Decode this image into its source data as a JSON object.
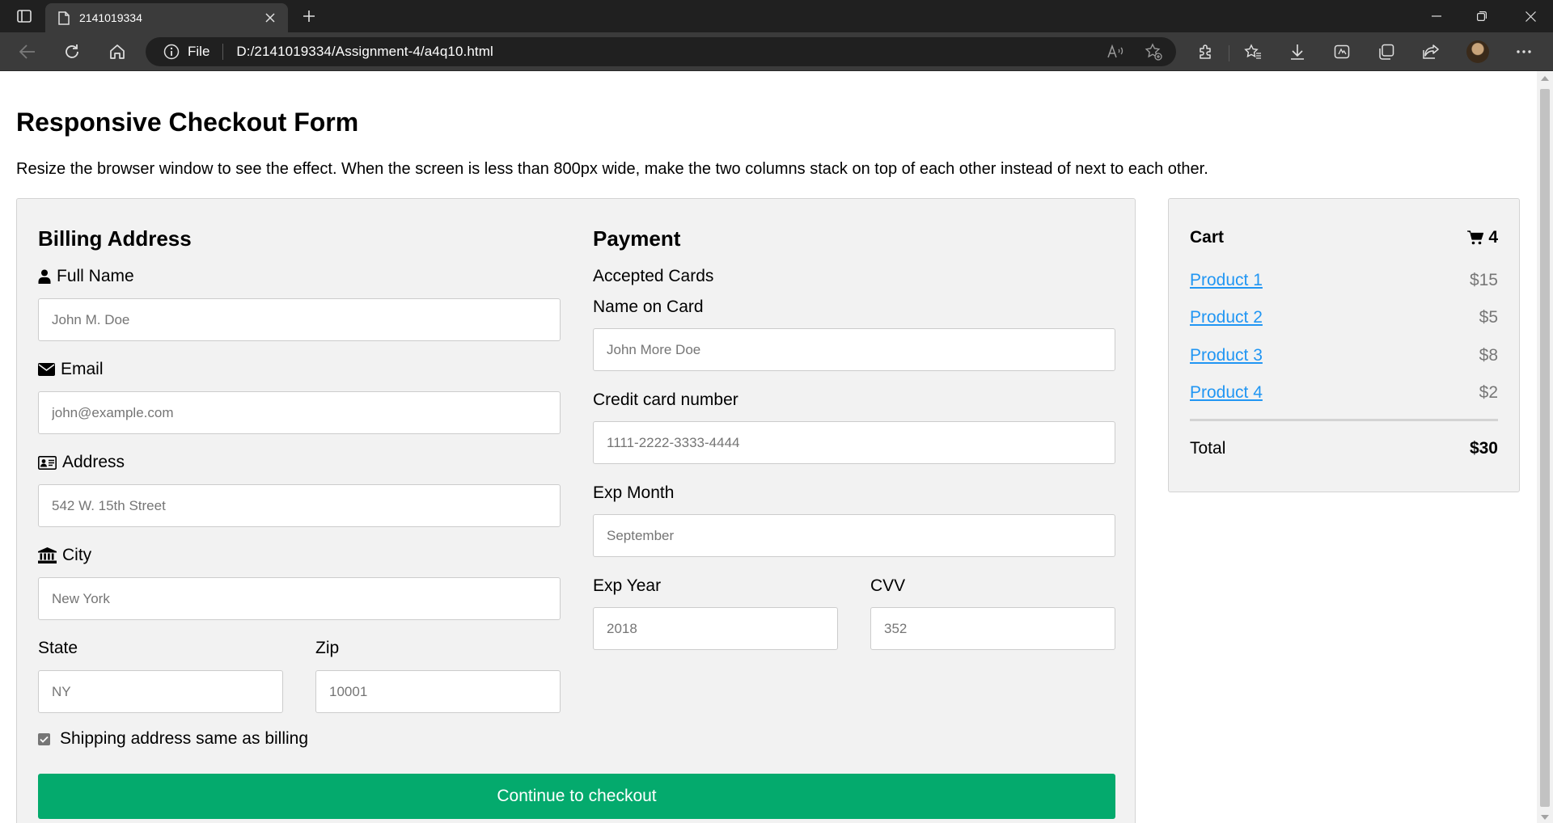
{
  "browser": {
    "tab_title": "2141019334",
    "address_scheme": "File",
    "url": "D:/2141019334/Assignment-4/a4q10.html"
  },
  "page": {
    "title": "Responsive Checkout Form",
    "description": "Resize the browser window to see the effect. When the screen is less than 800px wide, make the two columns stack on top of each other instead of next to each other."
  },
  "billing": {
    "title": "Billing Address",
    "full_name_label": "Full Name",
    "full_name_placeholder": "John M. Doe",
    "email_label": "Email",
    "email_placeholder": "john@example.com",
    "address_label": "Address",
    "address_placeholder": "542 W. 15th Street",
    "city_label": "City",
    "city_placeholder": "New York",
    "state_label": "State",
    "state_placeholder": "NY",
    "zip_label": "Zip",
    "zip_placeholder": "10001"
  },
  "payment": {
    "title": "Payment",
    "accepted_cards_label": "Accepted Cards",
    "name_on_card_label": "Name on Card",
    "name_on_card_placeholder": "John More Doe",
    "card_number_label": "Credit card number",
    "card_number_placeholder": "1111-2222-3333-4444",
    "exp_month_label": "Exp Month",
    "exp_month_placeholder": "September",
    "exp_year_label": "Exp Year",
    "exp_year_placeholder": "2018",
    "cvv_label": "CVV",
    "cvv_placeholder": "352"
  },
  "shipping_same_label": "Shipping address same as billing",
  "shipping_same_checked": true,
  "checkout_button": "Continue to checkout",
  "cart": {
    "title": "Cart",
    "count": "4",
    "items": [
      {
        "name": "Product 1",
        "price": "$15"
      },
      {
        "name": "Product 2",
        "price": "$5"
      },
      {
        "name": "Product 3",
        "price": "$8"
      },
      {
        "name": "Product 4",
        "price": "$2"
      }
    ],
    "total_label": "Total",
    "total_value": "$30"
  },
  "colors": {
    "accent_green": "#04aa6d",
    "link_blue": "#2196f3",
    "price_gray": "#777777",
    "panel_bg": "#f2f2f2"
  },
  "icons": [
    "tab-actions-icon",
    "page-icon",
    "close-icon",
    "plus-icon",
    "back-arrow-icon",
    "refresh-icon",
    "home-icon",
    "info-icon",
    "read-aloud-icon",
    "add-favorite-icon",
    "extensions-icon",
    "favorites-icon",
    "download-icon",
    "web-capture-icon",
    "collections-icon",
    "share-icon",
    "more-icon",
    "user-icon",
    "envelope-icon",
    "address-card-icon",
    "institution-icon",
    "cart-icon"
  ]
}
